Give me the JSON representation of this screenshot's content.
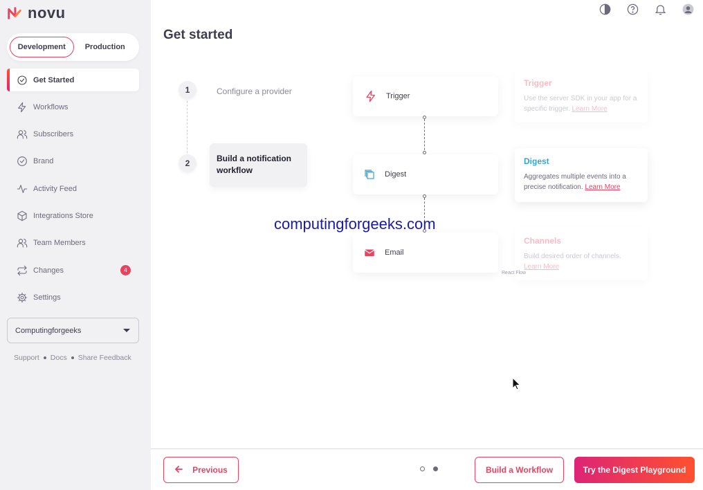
{
  "app": {
    "name": "novu"
  },
  "env": {
    "development": "Development",
    "production": "Production",
    "selected": "Development"
  },
  "sidebar": {
    "items": [
      {
        "label": "Get Started",
        "icon": "check-circle-icon"
      },
      {
        "label": "Workflows",
        "icon": "bolt-icon"
      },
      {
        "label": "Subscribers",
        "icon": "users-icon"
      },
      {
        "label": "Brand",
        "icon": "badge-check-icon"
      },
      {
        "label": "Activity Feed",
        "icon": "activity-icon"
      },
      {
        "label": "Integrations Store",
        "icon": "box-icon"
      },
      {
        "label": "Team Members",
        "icon": "team-icon"
      },
      {
        "label": "Changes",
        "icon": "swap-icon",
        "badge": "4"
      },
      {
        "label": "Settings",
        "icon": "gear-icon"
      }
    ],
    "org": "Computingforgeeks",
    "footer": {
      "support": "Support",
      "docs": "Docs",
      "feedback": "Share Feedback"
    }
  },
  "main": {
    "title": "Get started",
    "steps": [
      {
        "num": "1",
        "label": "Configure a provider"
      },
      {
        "num": "2",
        "label": "Build a notification workflow"
      }
    ],
    "nodes": [
      {
        "label": "Trigger",
        "icon": "bolt-icon"
      },
      {
        "label": "Digest",
        "icon": "digest-icon"
      },
      {
        "label": "Email",
        "icon": "email-icon"
      }
    ],
    "info": [
      {
        "title": "Trigger",
        "desc": "Use the server SDK in your app for a specific trigger.",
        "link": "Learn More"
      },
      {
        "title": "Digest",
        "desc": "Aggregates multiple events into a precise notification.",
        "link": "Learn More"
      },
      {
        "title": "Channels",
        "desc": "Build desired order of channels.",
        "link": "Learn More"
      }
    ],
    "react_flow": "React Flow",
    "watermark": "computingforgeeks.com"
  },
  "bottom": {
    "previous": "Previous",
    "build": "Build a Workflow",
    "try": "Try the Digest Playground",
    "page_total": 2,
    "page_current": 2
  },
  "colors": {
    "accent": "#e8435f",
    "digest_title": "#2ea8d6",
    "gradient_start": "#dd2476",
    "gradient_end": "#ff512f",
    "watermark": "#1a1aa8"
  }
}
